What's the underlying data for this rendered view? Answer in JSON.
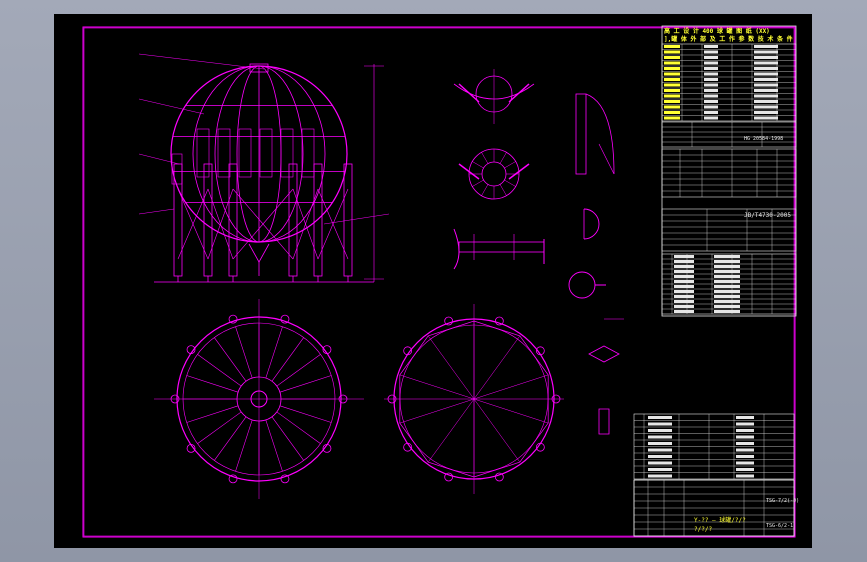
{
  "colors": {
    "background": "#000000",
    "frame": "#ff00ff",
    "text_yellow": "#ffff33",
    "text_white": "#e6e6e6",
    "viewport": "#9aa1b1"
  },
  "title_block": {
    "header_line1": "高 工 设 计 400 球 罐 图 纸 (XX)",
    "header_line2": "],罐 体 外 部 及 工 作 参 数 技 术 条 件",
    "standard_code": "JB/T4730-2005",
    "standard_code_2": "HG 20584-1998",
    "drawing_no": "Y-?? — 球罐/?/?",
    "footer_left": "?/?/?",
    "footer_code": "TSG-7/2(-0)",
    "footer_right": "TSG-6/2-1"
  }
}
